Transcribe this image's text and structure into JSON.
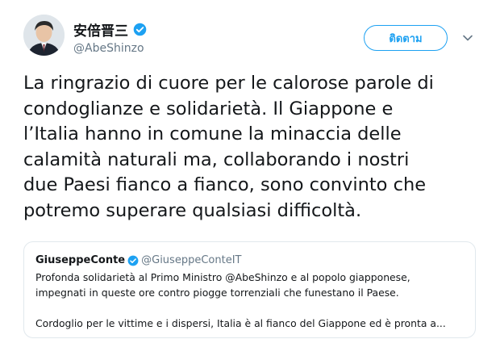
{
  "user": {
    "display_name": "安倍晋三",
    "handle": "@AbeShinzo"
  },
  "follow_label": "ติดตาม",
  "tweet_text": "La ringrazio di cuore per le calorose parole di\ncondoglianze e solidarietà. Il Giappone e\nl’Italia hanno in comune la minaccia delle\ncalamità naturali ma, collaborando i nostri\ndue Paesi fianco a fianco,  sono convinto che\npotremo superare qualsiasi difficoltà.",
  "quoted_tweet": {
    "display_name": "GiuseppeConte",
    "handle": "@GiuseppeConteIT",
    "text": "Profonda solidarietà al Primo Ministro @AbeShinzo e al popolo giapponese,\nimpegnati in queste ore contro piogge torrenziali che funestano il Paese.\n\nCordoglio per le vittime e i dispersi, Italia è al fianco del Giappone ed è pronta a..."
  },
  "colors": {
    "accent": "#1da1f2",
    "secondary_text": "#657786",
    "border": "#e1e8ed"
  },
  "icons": {
    "verified": "verified-badge-icon",
    "more": "chevron-down-icon"
  }
}
